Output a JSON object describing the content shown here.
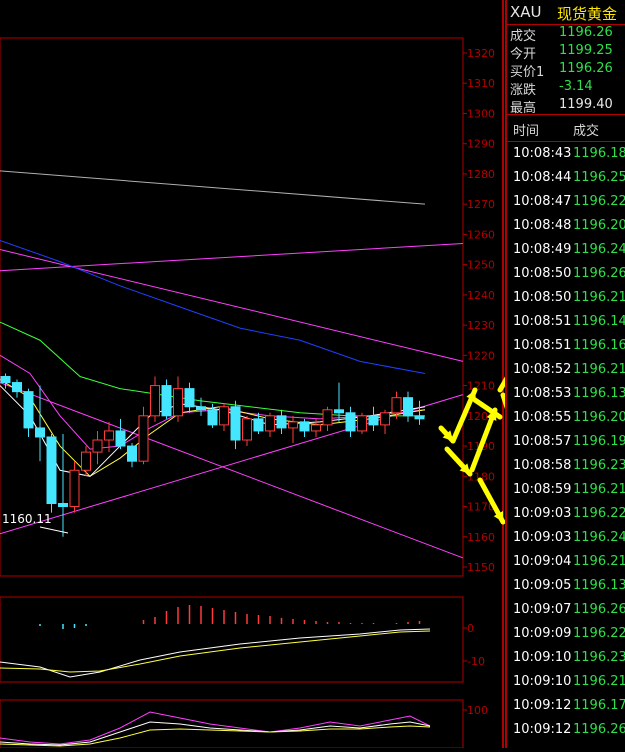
{
  "header": {
    "symbol": "XAU",
    "name": "现货黄金"
  },
  "quote": [
    {
      "label": "成交",
      "value": "1196.26",
      "color": "green"
    },
    {
      "label": "今开",
      "value": "1199.25",
      "color": "green"
    },
    {
      "label": "买价1",
      "value": "1196.26",
      "color": "green"
    },
    {
      "label": "涨跌",
      "value": "-3.14",
      "color": "green"
    },
    {
      "label": "最高",
      "value": "1199.40",
      "color": "white"
    }
  ],
  "ticks_header": {
    "time": "时间",
    "price": "成交"
  },
  "ticks": [
    {
      "time": "10:08:43",
      "price": "1196.18"
    },
    {
      "time": "10:08:44",
      "price": "1196.25"
    },
    {
      "time": "10:08:47",
      "price": "1196.22"
    },
    {
      "time": "10:08:48",
      "price": "1196.20"
    },
    {
      "time": "10:08:49",
      "price": "1196.24"
    },
    {
      "time": "10:08:50",
      "price": "1196.26"
    },
    {
      "time": "10:08:50",
      "price": "1196.21"
    },
    {
      "time": "10:08:51",
      "price": "1196.14"
    },
    {
      "time": "10:08:51",
      "price": "1196.16"
    },
    {
      "time": "10:08:52",
      "price": "1196.21"
    },
    {
      "time": "10:08:53",
      "price": "1196.13"
    },
    {
      "time": "10:08:55",
      "price": "1196.20"
    },
    {
      "time": "10:08:57",
      "price": "1196.19"
    },
    {
      "time": "10:08:58",
      "price": "1196.23"
    },
    {
      "time": "10:08:59",
      "price": "1196.21"
    },
    {
      "time": "10:09:03",
      "price": "1196.22"
    },
    {
      "time": "10:09:03",
      "price": "1196.24"
    },
    {
      "time": "10:09:04",
      "price": "1196.21"
    },
    {
      "time": "10:09:05",
      "price": "1196.13"
    },
    {
      "time": "10:09:07",
      "price": "1196.26"
    },
    {
      "time": "10:09:09",
      "price": "1196.22"
    },
    {
      "time": "10:09:10",
      "price": "1196.23"
    },
    {
      "time": "10:09:10",
      "price": "1196.21"
    },
    {
      "time": "10:09:12",
      "price": "1196.17"
    },
    {
      "time": "10:09:12",
      "price": "1196.26"
    }
  ],
  "price_axis": [
    "1320",
    "1310",
    "1300",
    "1290",
    "1280",
    "1270",
    "1260",
    "1250",
    "1240",
    "1230",
    "1220",
    "1210",
    "1200",
    "1190",
    "1180",
    "1170",
    "1160",
    "1150"
  ],
  "macd_axis": [
    "0",
    "-10"
  ],
  "kdj_axis": [
    "100"
  ],
  "low_marker": "1160.11",
  "colors": {
    "up": "#ff3b3b",
    "down": "#45e6ff",
    "axis": "#b00000",
    "ma5": "#ffffff",
    "ma10": "#ffff40",
    "ma20": "#3cff3c",
    "ma60": "#2040ff",
    "channel": "#ff40ff",
    "arrow": "#ffff00"
  },
  "chart_data": {
    "type": "candlestick",
    "title": "",
    "ylim": [
      1150,
      1320
    ],
    "candles": [
      [
        1213,
        1214,
        1209,
        1211
      ],
      [
        1211,
        1212,
        1206,
        1208
      ],
      [
        1208,
        1209,
        1193,
        1196
      ],
      [
        1196,
        1210,
        1185,
        1193
      ],
      [
        1193,
        1194,
        1168,
        1171
      ],
      [
        1171,
        1194,
        1160,
        1170
      ],
      [
        1170,
        1185,
        1168,
        1182
      ],
      [
        1182,
        1190,
        1180,
        1188
      ],
      [
        1188,
        1195,
        1184,
        1192
      ],
      [
        1192,
        1198,
        1188,
        1195
      ],
      [
        1195,
        1199,
        1189,
        1190
      ],
      [
        1190,
        1191,
        1183,
        1185
      ],
      [
        1185,
        1203,
        1184,
        1200
      ],
      [
        1200,
        1213,
        1198,
        1210
      ],
      [
        1210,
        1212,
        1199,
        1200
      ],
      [
        1200,
        1213,
        1198,
        1209
      ],
      [
        1209,
        1211,
        1201,
        1203
      ],
      [
        1203,
        1206,
        1200,
        1202
      ],
      [
        1202,
        1204,
        1196,
        1197
      ],
      [
        1197,
        1204,
        1195,
        1203
      ],
      [
        1203,
        1205,
        1189,
        1192
      ],
      [
        1192,
        1200,
        1190,
        1199
      ],
      [
        1199,
        1201,
        1194,
        1195
      ],
      [
        1195,
        1201,
        1193,
        1200
      ],
      [
        1200,
        1202,
        1194,
        1196
      ],
      [
        1196,
        1200,
        1191,
        1198
      ],
      [
        1198,
        1199,
        1193,
        1195
      ],
      [
        1195,
        1199,
        1193,
        1197
      ],
      [
        1197,
        1203,
        1195,
        1202
      ],
      [
        1202,
        1211,
        1198,
        1201
      ],
      [
        1201,
        1203,
        1193,
        1195
      ],
      [
        1195,
        1201,
        1194,
        1200
      ],
      [
        1200,
        1203,
        1195,
        1197
      ],
      [
        1197,
        1202,
        1194,
        1201
      ],
      [
        1201,
        1208,
        1199,
        1206
      ],
      [
        1206,
        1208,
        1198,
        1200
      ],
      [
        1200,
        1205,
        1197,
        1199
      ]
    ]
  }
}
